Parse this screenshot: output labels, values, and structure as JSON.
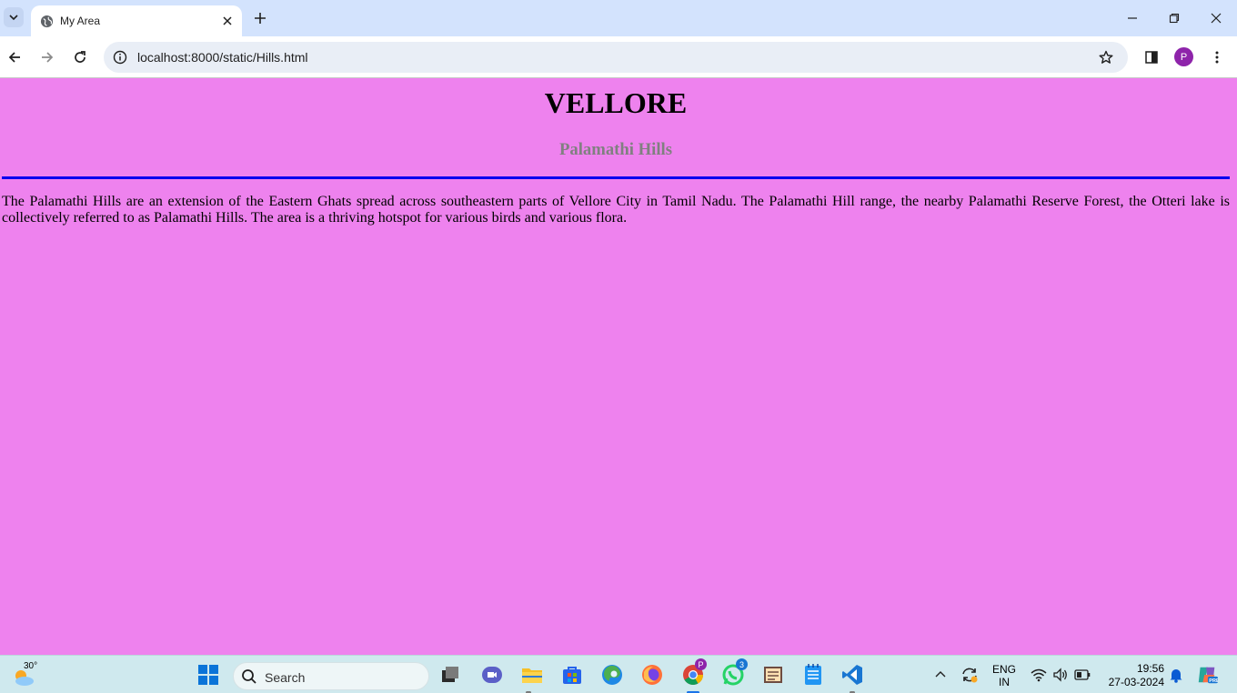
{
  "browser": {
    "tab_title": "My Area",
    "url": "localhost:8000/static/Hills.html",
    "profile_initial": "P"
  },
  "page": {
    "heading": "VELLORE",
    "subheading": "Palamathi Hills",
    "paragraph": "The Palamathi Hills are an extension of the Eastern Ghats spread across southeastern parts of Vellore City in Tamil Nadu. The Palamathi Hill range, the nearby Palamathi Reserve Forest, the Otteri lake is collectively referred to as Palamathi Hills. The area is a thriving hotspot for various birds and various flora.",
    "background_color": "#ee82ee",
    "rule_color": "#0000ee"
  },
  "taskbar": {
    "weather_temp": "30°",
    "search_placeholder": "Search",
    "chrome_badge": "P",
    "whatsapp_badge": "3",
    "lang_line1": "ENG",
    "lang_line2": "IN",
    "time": "19:56",
    "date": "27-03-2024"
  },
  "icons": [
    "tab-search-icon",
    "globe-icon",
    "close-icon",
    "plus-icon",
    "minimize-icon",
    "restore-icon",
    "back-icon",
    "forward-icon",
    "reload-icon",
    "info-icon",
    "star-icon",
    "sidepanel-icon",
    "menu-icon",
    "windows-icon",
    "search-icon",
    "task-view-icon",
    "meet-icon",
    "file-explorer-icon",
    "store-icon",
    "edge-icon",
    "firefox-icon",
    "chrome-icon",
    "whatsapp-icon",
    "app-icon",
    "notepad-icon",
    "vscode-icon",
    "chevron-up-icon",
    "sync-icon",
    "wifi-icon",
    "volume-icon",
    "battery-icon",
    "bell-icon",
    "copilot-icon"
  ]
}
